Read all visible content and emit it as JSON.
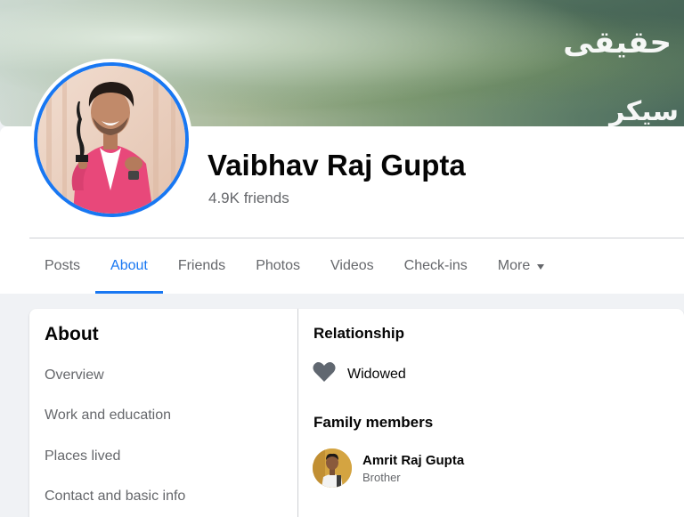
{
  "cover": {
    "overlay_text_1": "حقیقی",
    "overlay_text_2": "سیکر"
  },
  "profile": {
    "name": "Vaibhav Raj Gupta",
    "friends": "4.9K friends"
  },
  "tabs": [
    {
      "label": "Posts",
      "active": false
    },
    {
      "label": "About",
      "active": true
    },
    {
      "label": "Friends",
      "active": false
    },
    {
      "label": "Photos",
      "active": false
    },
    {
      "label": "Videos",
      "active": false
    },
    {
      "label": "Check-ins",
      "active": false
    },
    {
      "label": "More",
      "active": false
    }
  ],
  "about": {
    "title": "About",
    "nav": [
      {
        "label": "Overview"
      },
      {
        "label": "Work and education"
      },
      {
        "label": "Places lived"
      },
      {
        "label": "Contact and basic info"
      }
    ],
    "relationship": {
      "heading": "Relationship",
      "status": "Widowed",
      "icon": "heart-icon"
    },
    "family": {
      "heading": "Family members",
      "members": [
        {
          "name": "Amrit Raj Gupta",
          "relation": "Brother"
        }
      ]
    }
  },
  "colors": {
    "accent": "#1877f2",
    "muted_text": "#65676b",
    "background": "#f0f2f5",
    "heart_gray": "#606770"
  }
}
